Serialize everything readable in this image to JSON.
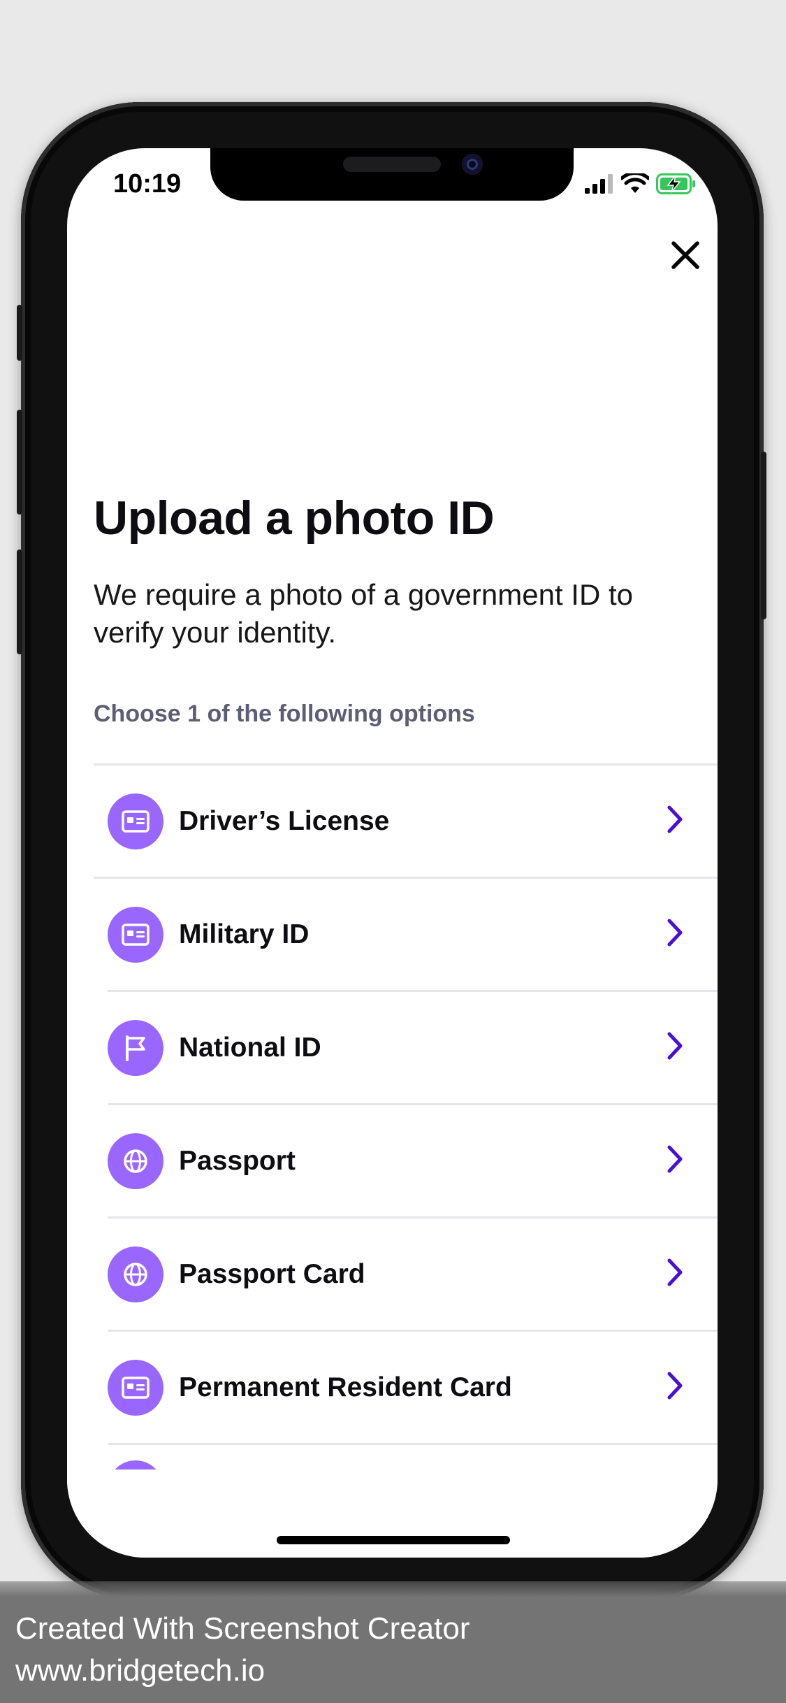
{
  "status_bar": {
    "time": "10:19"
  },
  "modal": {
    "title": "Upload a photo ID",
    "subtitle": "We require a photo of a government ID to verify your identity.",
    "section_label": "Choose 1 of the following options",
    "options": [
      {
        "label": "Driver’s License",
        "icon": "id-card-icon"
      },
      {
        "label": "Military ID",
        "icon": "id-card-icon"
      },
      {
        "label": "National ID",
        "icon": "flag-icon"
      },
      {
        "label": "Passport",
        "icon": "globe-icon"
      },
      {
        "label": "Passport Card",
        "icon": "globe-icon"
      },
      {
        "label": "Permanent Resident Card",
        "icon": "id-card-icon"
      }
    ]
  },
  "colors": {
    "accent": "#9966ff",
    "chevron": "#4a0fd6",
    "title_text": "#0e0e12",
    "section_label": "#5d5d74",
    "battery": "#34c759"
  },
  "watermark": {
    "line1": "Created With Screenshot Creator",
    "line2": "www.bridgetech.io"
  }
}
